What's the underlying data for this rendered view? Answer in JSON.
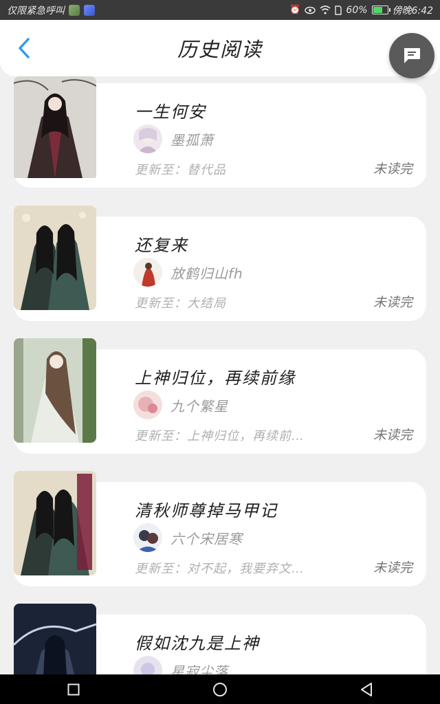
{
  "statusbar": {
    "carrier_text": "仅限紧急呼叫",
    "battery_text": "60%",
    "time_text": "傍晚6:42",
    "icons": [
      "alarm-icon",
      "eye-icon",
      "wifi-icon",
      "sim-icon",
      "battery-icon"
    ],
    "battery_level_fraction": 0.6
  },
  "header": {
    "title": "历史阅读",
    "back_icon": "chevron-left-icon",
    "chat_icon": "chat-bubble-icon"
  },
  "books": [
    {
      "title": "一生何安",
      "author": "墨孤萧",
      "update": "更新至：替代品",
      "status": "未读完"
    },
    {
      "title": "还复来",
      "author": "放鹤归山fh",
      "update": "更新至：大结局",
      "status": "未读完"
    },
    {
      "title": "上神归位，再续前缘",
      "author": "九个繁星",
      "update": "更新至：上神归位，再续前…",
      "status": "未读完"
    },
    {
      "title": "清秋师尊掉马甲记",
      "author": "六个宋居寒",
      "update": "更新至：对不起，我要弃文…",
      "status": "未读完"
    },
    {
      "title": "假如沈九是上神",
      "author": "星寂尘落",
      "update": "",
      "status": ""
    }
  ],
  "navbar": {
    "icons": [
      "recent-apps-icon",
      "home-icon",
      "back-icon"
    ]
  },
  "colors": {
    "accent": "#2f9bf0",
    "background": "#f0f0f0",
    "fab": "#5a5a5a"
  }
}
